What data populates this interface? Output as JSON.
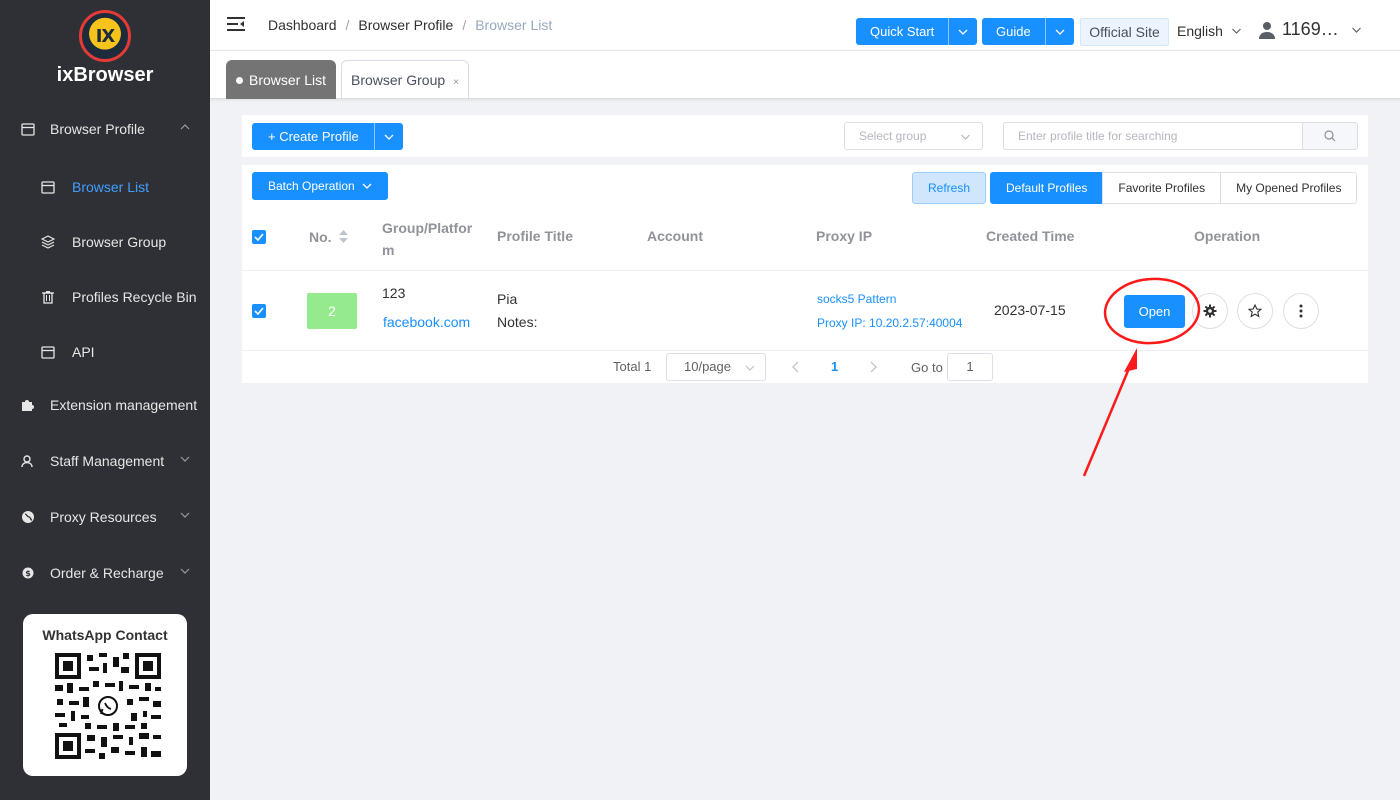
{
  "app": {
    "name": "ixBrowser",
    "logo_mark": "IX"
  },
  "sidebar": {
    "items": [
      {
        "label": "Browser Profile",
        "icon": "calendar-icon",
        "expandable": true,
        "expanded": true
      },
      {
        "label": "Browser List",
        "icon": "calendar-icon",
        "active": true
      },
      {
        "label": "Browser Group",
        "icon": "layers-icon"
      },
      {
        "label": "Profiles Recycle Bin",
        "icon": "trash-icon"
      },
      {
        "label": "API",
        "icon": "calendar-icon"
      },
      {
        "label": "Extension management",
        "icon": "puzzle-icon"
      },
      {
        "label": "Staff Management",
        "icon": "staff-icon",
        "expandable": true
      },
      {
        "label": "Proxy Resources",
        "icon": "globe-icon",
        "expandable": true
      },
      {
        "label": "Order & Recharge",
        "icon": "coin-icon",
        "expandable": true
      }
    ],
    "whatsapp_title": "WhatsApp Contact"
  },
  "header": {
    "breadcrumb": [
      "Dashboard",
      "Browser Profile",
      "Browser List"
    ],
    "quick_start": "Quick Start",
    "guide": "Guide",
    "official_site": "Official Site",
    "language": "English",
    "user": "1169…"
  },
  "tabs": [
    {
      "label": "Browser List",
      "active": true
    },
    {
      "label": "Browser Group",
      "closable": true,
      "close_glyph": "×"
    }
  ],
  "toolbar": {
    "create_profile": "Create Profile",
    "select_group_placeholder": "Select group",
    "search_placeholder": "Enter profile title for searching"
  },
  "table": {
    "batch_operation": "Batch Operation",
    "refresh": "Refresh",
    "filters": [
      "Default Profiles",
      "Favorite Profiles",
      "My Opened Profiles"
    ],
    "active_filter": "Default Profiles",
    "columns": {
      "no": "No.",
      "group_platform_1": "Group/Platfor",
      "group_platform_2": "m",
      "profile_title": "Profile Title",
      "account": "Account",
      "proxy_ip": "Proxy IP",
      "created_time": "Created Time",
      "operation": "Operation"
    },
    "rows": [
      {
        "checked": true,
        "no": "2",
        "group": "123",
        "platform": "facebook.com",
        "title": "Pia",
        "notes": "Notes:",
        "account": "",
        "proxy_type": "socks5 Pattern",
        "proxy_ip": "Proxy IP: 10.20.2.57:40004",
        "created": "2023-07-15",
        "open_label": "Open"
      }
    ]
  },
  "pagination": {
    "total": "Total 1",
    "page_size": "10/page",
    "current_page": "1",
    "goto_label": "Go to",
    "goto_value": "1"
  },
  "colors": {
    "primary": "#1890ff",
    "sidebar_bg": "#2f3035",
    "annotation_red": "#ff1a1a",
    "row_badge": "#95ea8d"
  }
}
